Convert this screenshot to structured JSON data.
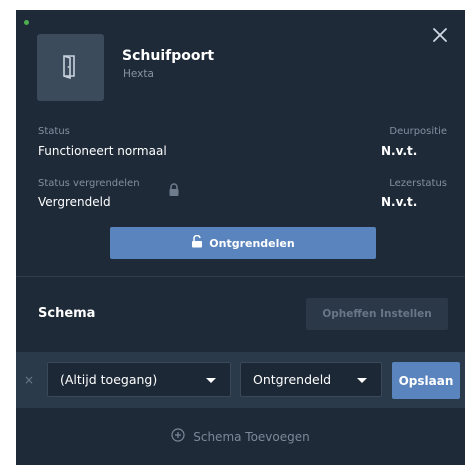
{
  "header": {
    "title": "Schuifpoort",
    "subtitle": "Hexta",
    "close_icon": "close-icon",
    "device_icon": "door-icon"
  },
  "status": {
    "status_label": "Status",
    "status_value": "Functioneert normaal",
    "door_position_label": "Deurpositie",
    "door_position_value": "N.v.t.",
    "lock_status_label": "Status vergrendelen",
    "lock_status_value": "Vergrendeld",
    "reader_status_label": "Lezerstatus",
    "reader_status_value": "N.v.t."
  },
  "unlock_button": {
    "label": "Ontgrendelen",
    "icon": "unlock-icon"
  },
  "schema": {
    "title": "Schema",
    "override_button": "Opheffen Instellen",
    "row": {
      "remove_icon": "×",
      "access_select": "(Altijd toegang)",
      "state_select": "Ontgrendeld",
      "save_button": "Opslaan"
    },
    "add_label": "Schema Toevoegen",
    "add_icon": "plus-circle-icon"
  },
  "colors": {
    "panel_bg": "#1e2a38",
    "accent": "#5a84bd",
    "status_indicator": "#4caf50"
  }
}
